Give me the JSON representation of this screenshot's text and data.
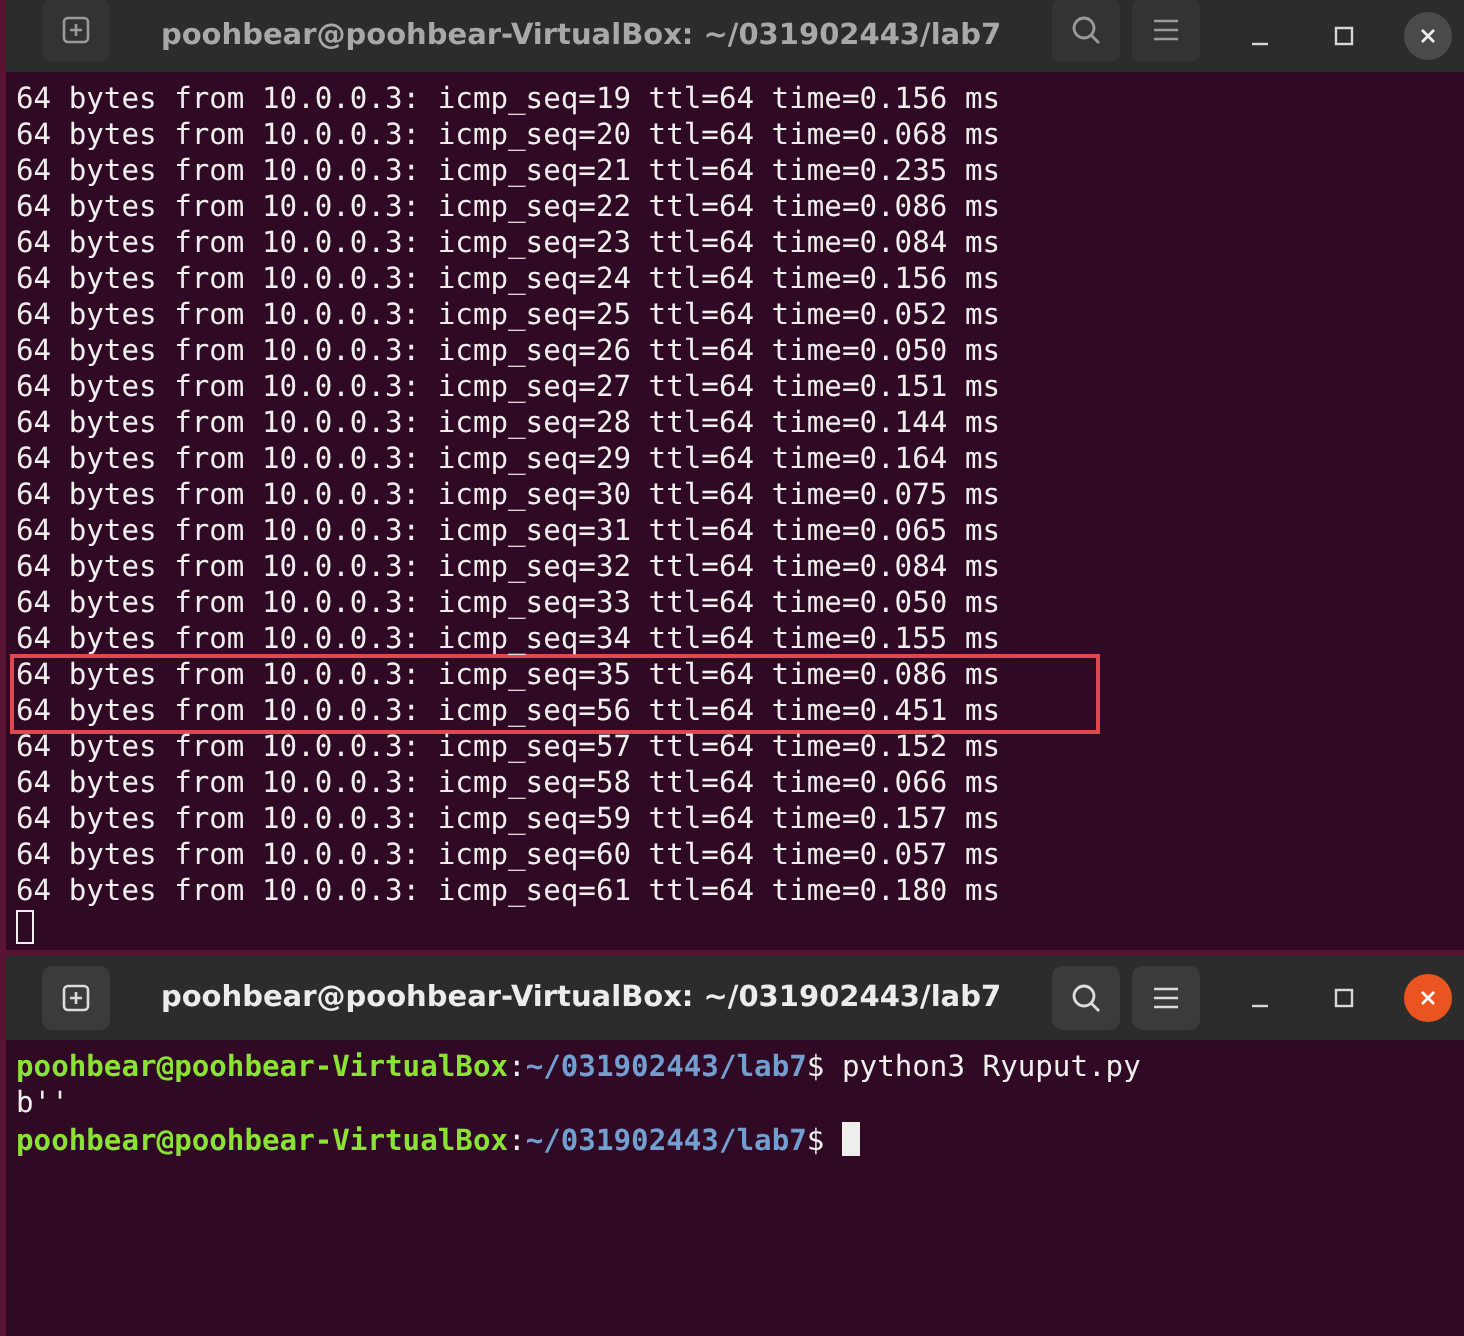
{
  "windows": [
    {
      "title": "poohbear@poohbear-VirtualBox: ~/031902443/lab7",
      "active": false,
      "lines": [
        {
          "kind": "output",
          "text": "64 bytes from 10.0.0.3: icmp_seq=19 ttl=64 time=0.156 ms",
          "highlighted": false
        },
        {
          "kind": "output",
          "text": "64 bytes from 10.0.0.3: icmp_seq=20 ttl=64 time=0.068 ms",
          "highlighted": false
        },
        {
          "kind": "output",
          "text": "64 bytes from 10.0.0.3: icmp_seq=21 ttl=64 time=0.235 ms",
          "highlighted": false
        },
        {
          "kind": "output",
          "text": "64 bytes from 10.0.0.3: icmp_seq=22 ttl=64 time=0.086 ms",
          "highlighted": false
        },
        {
          "kind": "output",
          "text": "64 bytes from 10.0.0.3: icmp_seq=23 ttl=64 time=0.084 ms",
          "highlighted": false
        },
        {
          "kind": "output",
          "text": "64 bytes from 10.0.0.3: icmp_seq=24 ttl=64 time=0.156 ms",
          "highlighted": false
        },
        {
          "kind": "output",
          "text": "64 bytes from 10.0.0.3: icmp_seq=25 ttl=64 time=0.052 ms",
          "highlighted": false
        },
        {
          "kind": "output",
          "text": "64 bytes from 10.0.0.3: icmp_seq=26 ttl=64 time=0.050 ms",
          "highlighted": false
        },
        {
          "kind": "output",
          "text": "64 bytes from 10.0.0.3: icmp_seq=27 ttl=64 time=0.151 ms",
          "highlighted": false
        },
        {
          "kind": "output",
          "text": "64 bytes from 10.0.0.3: icmp_seq=28 ttl=64 time=0.144 ms",
          "highlighted": false
        },
        {
          "kind": "output",
          "text": "64 bytes from 10.0.0.3: icmp_seq=29 ttl=64 time=0.164 ms",
          "highlighted": false
        },
        {
          "kind": "output",
          "text": "64 bytes from 10.0.0.3: icmp_seq=30 ttl=64 time=0.075 ms",
          "highlighted": false
        },
        {
          "kind": "output",
          "text": "64 bytes from 10.0.0.3: icmp_seq=31 ttl=64 time=0.065 ms",
          "highlighted": false
        },
        {
          "kind": "output",
          "text": "64 bytes from 10.0.0.3: icmp_seq=32 ttl=64 time=0.084 ms",
          "highlighted": false
        },
        {
          "kind": "output",
          "text": "64 bytes from 10.0.0.3: icmp_seq=33 ttl=64 time=0.050 ms",
          "highlighted": false
        },
        {
          "kind": "output",
          "text": "64 bytes from 10.0.0.3: icmp_seq=34 ttl=64 time=0.155 ms",
          "highlighted": false
        },
        {
          "kind": "output",
          "text": "64 bytes from 10.0.0.3: icmp_seq=35 ttl=64 time=0.086 ms",
          "highlighted": true
        },
        {
          "kind": "output",
          "text": "64 bytes from 10.0.0.3: icmp_seq=56 ttl=64 time=0.451 ms",
          "highlighted": true
        },
        {
          "kind": "output",
          "text": "64 bytes from 10.0.0.3: icmp_seq=57 ttl=64 time=0.152 ms",
          "highlighted": false
        },
        {
          "kind": "output",
          "text": "64 bytes from 10.0.0.3: icmp_seq=58 ttl=64 time=0.066 ms",
          "highlighted": false
        },
        {
          "kind": "output",
          "text": "64 bytes from 10.0.0.3: icmp_seq=59 ttl=64 time=0.157 ms",
          "highlighted": false
        },
        {
          "kind": "output",
          "text": "64 bytes from 10.0.0.3: icmp_seq=60 ttl=64 time=0.057 ms",
          "highlighted": false
        },
        {
          "kind": "output",
          "text": "64 bytes from 10.0.0.3: icmp_seq=61 ttl=64 time=0.180 ms",
          "highlighted": false
        }
      ]
    },
    {
      "title": "poohbear@poohbear-VirtualBox: ~/031902443/lab7",
      "active": true,
      "lines": [
        {
          "kind": "prompt",
          "user": "poohbear@poohbear-VirtualBox",
          "sep": ":",
          "path": "~/031902443/lab7",
          "symbol": "$",
          "command": "python3 Ryuput.py",
          "highlighted": false
        },
        {
          "kind": "output",
          "text": "b''",
          "highlighted": false
        },
        {
          "kind": "prompt",
          "user": "poohbear@poohbear-VirtualBox",
          "sep": ":",
          "path": "~/031902443/lab7",
          "symbol": "$",
          "highlighted": false
        }
      ]
    }
  ]
}
